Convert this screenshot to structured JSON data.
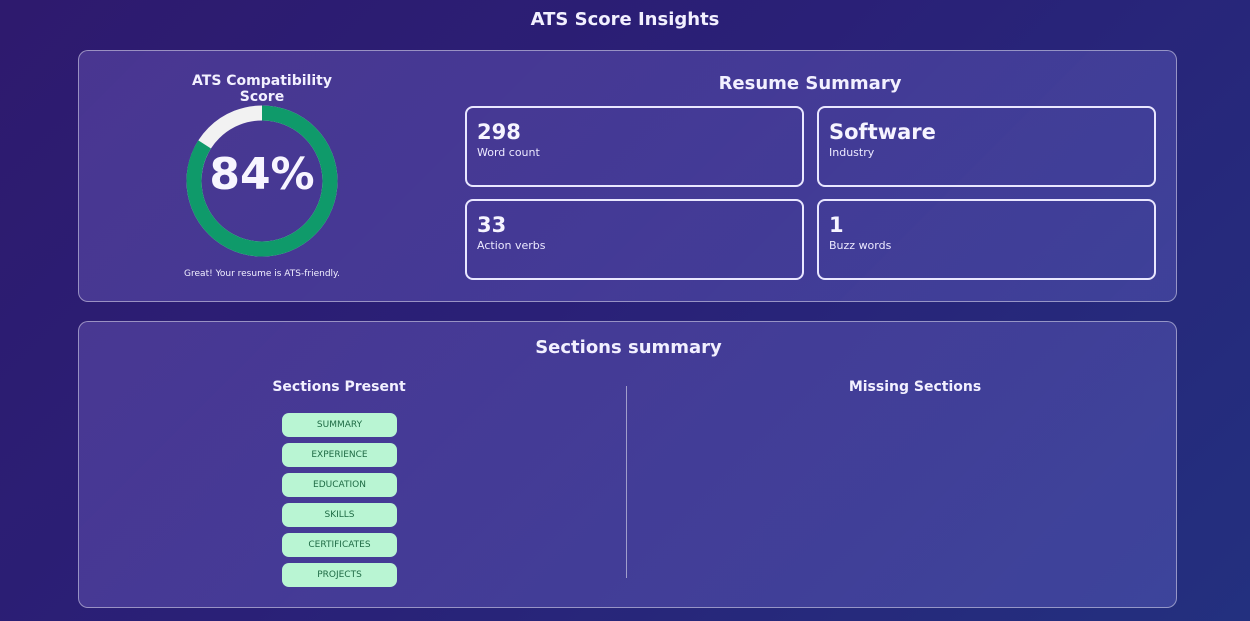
{
  "page": {
    "title": "ATS Score Insights"
  },
  "score": {
    "title": "ATS Compatibility Score",
    "value_text": "84%",
    "value": 84,
    "message": "Great! Your resume is ATS-friendly.",
    "ring_color": "#0f9a6a",
    "track_color": "#f2f2f2"
  },
  "summary": {
    "title": "Resume Summary",
    "cards": [
      {
        "value": "298",
        "label": "Word count"
      },
      {
        "value": "Software",
        "label": "Industry"
      },
      {
        "value": "33",
        "label": "Action verbs"
      },
      {
        "value": "1",
        "label": "Buzz words"
      }
    ]
  },
  "sections": {
    "title": "Sections summary",
    "present_title": "Sections Present",
    "missing_title": "Missing Sections",
    "present": [
      "SUMMARY",
      "EXPERIENCE",
      "EDUCATION",
      "SKILLS",
      "CERTIFICATES",
      "PROJECTS"
    ],
    "missing": []
  }
}
